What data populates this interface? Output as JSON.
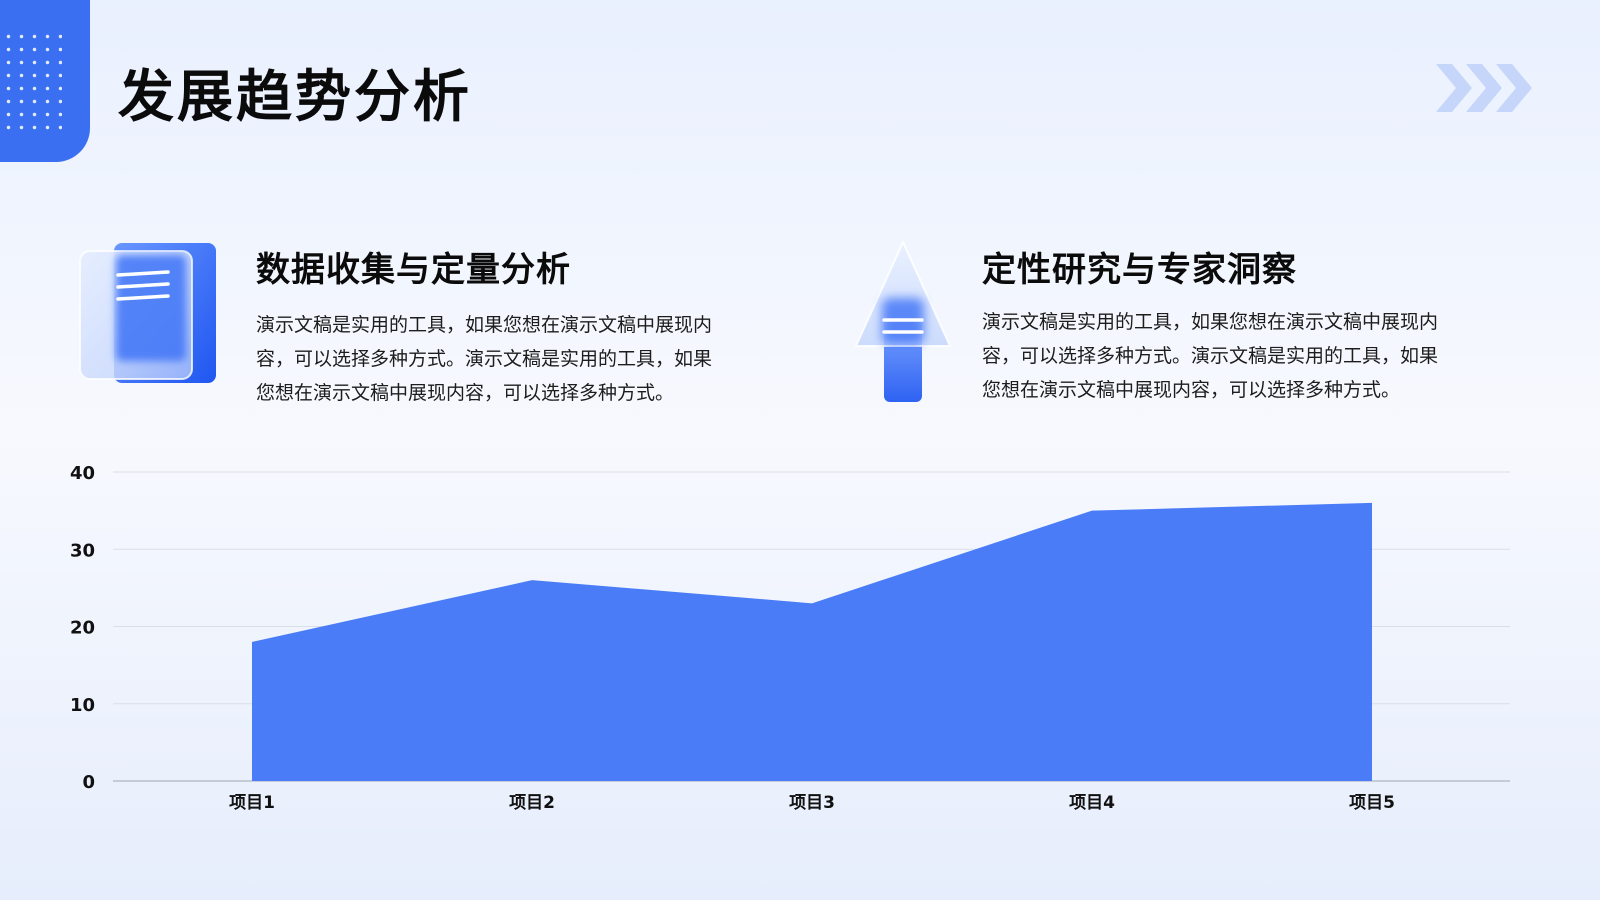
{
  "page": {
    "title": "发展趋势分析"
  },
  "decor": {
    "corner_icon": "dot-grid-corner",
    "arrows_icon": "triple-chevron-right-icon",
    "accent_color": "#3a6ff2",
    "light_accent": "#c6d6fb"
  },
  "sections": [
    {
      "icon": "document-icon",
      "title": "数据收集与定量分析",
      "lines": [
        "演示文稿是实用的工具，如果您想在演示文稿中展现内",
        "容，可以选择多种方式。演示文稿是实用的工具，如果",
        "您想在演示文稿中展现内容，可以选择多种方式。"
      ]
    },
    {
      "icon": "arrow-up-icon",
      "title": "定性研究与专家洞察",
      "lines": [
        "演示文稿是实用的工具，如果您想在演示文稿中展现内",
        "容，可以选择多种方式。演示文稿是实用的工具，如果",
        "您想在演示文稿中展现内容，可以选择多种方式。"
      ]
    }
  ],
  "chart_data": {
    "type": "area",
    "categories": [
      "项目1",
      "项目2",
      "项目3",
      "项目4",
      "项目5"
    ],
    "series": [
      {
        "values": [
          18,
          26,
          23,
          35,
          36
        ],
        "color": "#4a7cf8"
      }
    ],
    "y_ticks": [
      "0",
      "10",
      "20",
      "30",
      "40"
    ],
    "ylim": [
      0,
      40
    ],
    "grid": true,
    "legend": "none"
  }
}
